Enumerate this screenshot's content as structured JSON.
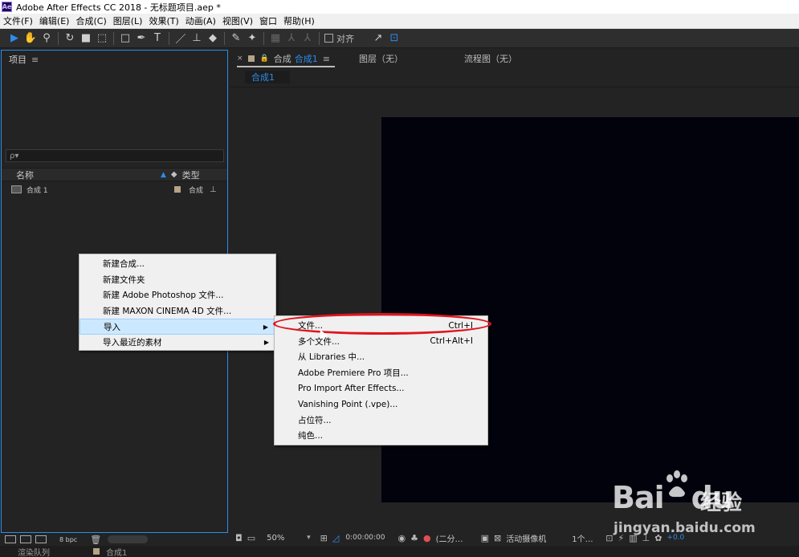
{
  "window": {
    "title": "Adobe After Effects CC 2018 - 无标题项目.aep *",
    "logo": "Ae"
  },
  "menubar": [
    "文件(F)",
    "编辑(E)",
    "合成(C)",
    "图层(L)",
    "效果(T)",
    "动画(A)",
    "视图(V)",
    "窗口",
    "帮助(H)"
  ],
  "toolbar": {
    "snap_label": "对齐"
  },
  "project": {
    "panel_title": "项目",
    "search_placeholder": "ρ▾",
    "columns": {
      "name": "名称",
      "type": "类型"
    },
    "items": [
      {
        "name": "合成 1",
        "type": "合成"
      }
    ],
    "footer_bpc": "8 bpc"
  },
  "composition": {
    "tab_prefix": "合成",
    "tab_active": "合成1",
    "tab_layer": "图层（无）",
    "tab_flowchart": "流程图（无）",
    "subtab": "合成1",
    "canvas_color": "#02020d"
  },
  "viewer_footer": {
    "zoom": "50%",
    "timecode": "0:00:00:00",
    "resolution": "(二分…",
    "camera": "活动摄像机",
    "views": "1个…",
    "exposure": "+0.0"
  },
  "bottom_strip": {
    "left": "渲染队列",
    "right": "合成1"
  },
  "context_menu": {
    "items": [
      {
        "label": "新建合成..."
      },
      {
        "label": "新建文件夹"
      },
      {
        "label": "新建 Adobe Photoshop 文件..."
      },
      {
        "label": "新建 MAXON CINEMA 4D 文件..."
      },
      {
        "label": "导入",
        "submenu": true
      },
      {
        "label": "导入最近的素材",
        "submenu": true
      }
    ]
  },
  "import_submenu": {
    "items": [
      {
        "label": "文件...",
        "shortcut": "Ctrl+I"
      },
      {
        "label": "多个文件...",
        "shortcut": "Ctrl+Alt+I"
      },
      {
        "label": "从 Libraries 中..."
      },
      {
        "label": "Adobe Premiere Pro 项目..."
      },
      {
        "label": "Pro Import After Effects..."
      },
      {
        "label": "Vanishing Point (.vpe)..."
      },
      {
        "label": "占位符..."
      },
      {
        "label": "纯色..."
      }
    ]
  },
  "colors": {
    "accent": "#2d8ceb",
    "annotation": "#e0141e",
    "menu_highlight": "#cce8ff",
    "label_swatch": "#b4a386"
  },
  "watermark": {
    "brand": "Bai",
    "brand2": "du",
    "cn": "经验",
    "url": "jingyan.baidu.com"
  }
}
